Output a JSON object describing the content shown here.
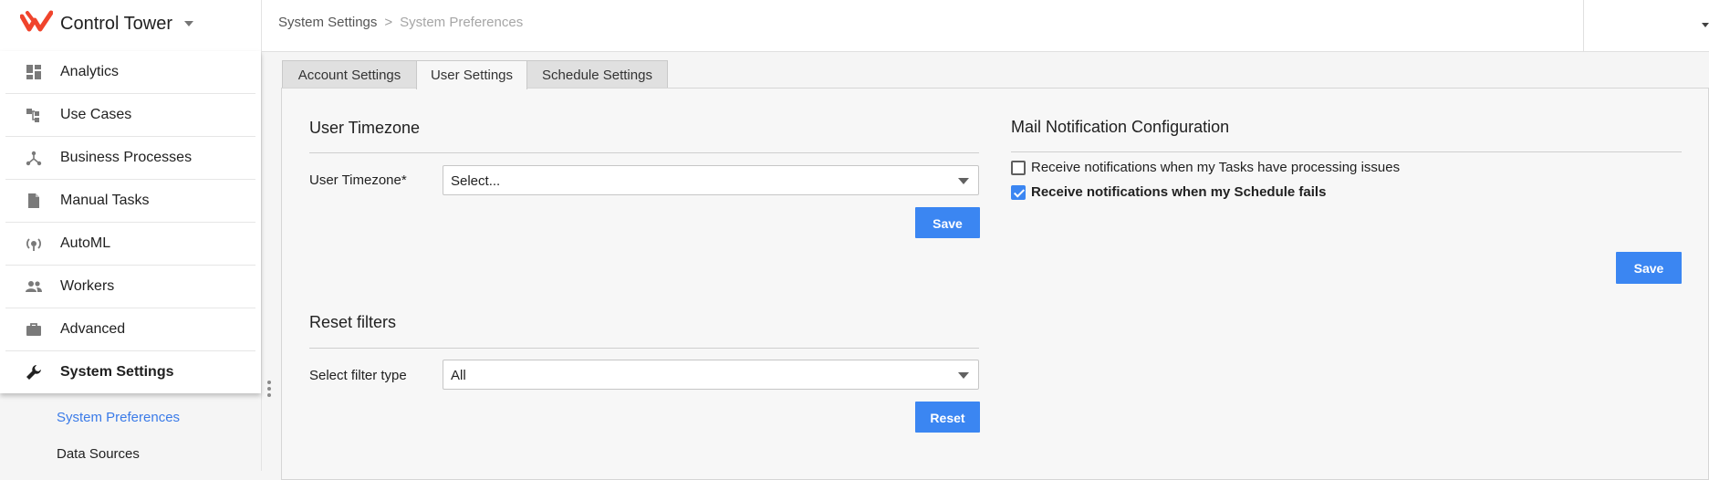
{
  "app": {
    "title": "Control Tower"
  },
  "sidebar": {
    "items": [
      {
        "label": "Analytics",
        "icon": "dashboard-icon"
      },
      {
        "label": "Use Cases",
        "icon": "use-cases-icon"
      },
      {
        "label": "Business Processes",
        "icon": "process-icon"
      },
      {
        "label": "Manual Tasks",
        "icon": "document-icon"
      },
      {
        "label": "AutoML",
        "icon": "automl-icon"
      },
      {
        "label": "Workers",
        "icon": "people-icon"
      },
      {
        "label": "Advanced",
        "icon": "briefcase-icon"
      },
      {
        "label": "System Settings",
        "icon": "wrench-icon",
        "active": true
      }
    ],
    "sub_items": [
      {
        "label": "System Preferences",
        "selected": true
      },
      {
        "label": "Data Sources"
      }
    ]
  },
  "breadcrumb": {
    "parent": "System Settings",
    "current": "System Preferences"
  },
  "tabs": [
    {
      "label": "Account Settings"
    },
    {
      "label": "User Settings",
      "active": true
    },
    {
      "label": "Schedule Settings"
    }
  ],
  "user_timezone": {
    "heading": "User Timezone",
    "field_label": "User Timezone*",
    "select_value": "Select...",
    "save_label": "Save"
  },
  "reset_filters": {
    "heading": "Reset filters",
    "field_label": "Select filter type",
    "select_value": "All",
    "reset_label": "Reset"
  },
  "mail": {
    "heading": "Mail Notification Configuration",
    "options": [
      {
        "label": "Receive notifications when my Tasks have processing issues",
        "checked": false
      },
      {
        "label": "Receive notifications when my Schedule fails",
        "checked": true
      }
    ],
    "save_label": "Save"
  },
  "colors": {
    "accent": "#3b86f2",
    "brand": "#f0442c",
    "link": "#3b7be8"
  }
}
